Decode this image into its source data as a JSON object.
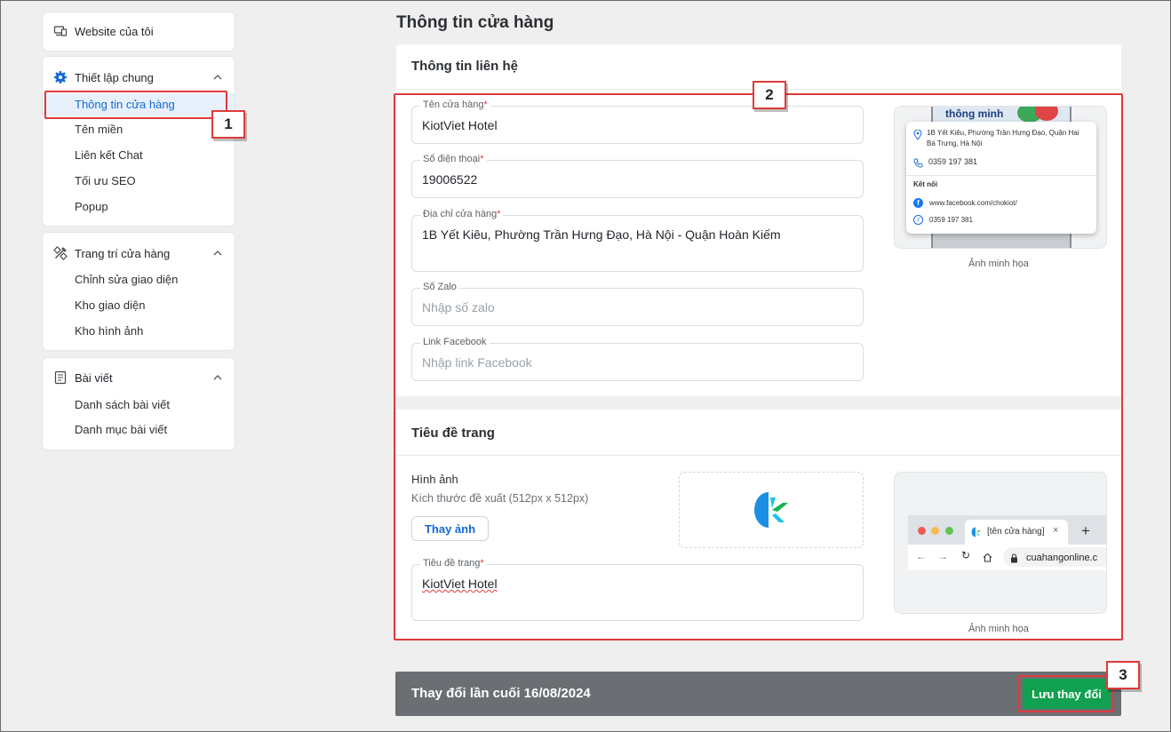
{
  "sidebar": {
    "website": "Website của tôi",
    "general": {
      "title": "Thiết lập chung",
      "items": [
        "Thông tin cửa hàng",
        "Tên miền",
        "Liên kết Chat",
        "Tối ưu SEO",
        "Popup"
      ]
    },
    "decor": {
      "title": "Trang trí cửa hàng",
      "items": [
        "Chỉnh sửa giao diện",
        "Kho giao diện",
        "Kho hình ảnh"
      ]
    },
    "posts": {
      "title": "Bài viết",
      "items": [
        "Danh sách bài viết",
        "Danh mục bài viết"
      ]
    }
  },
  "page_title": "Thông tin cửa hàng",
  "contact": {
    "title": "Thông tin liên hệ",
    "store_name": {
      "label": "Tên cửa hàng",
      "value": "KiotViet Hotel"
    },
    "phone": {
      "label": "Số điện thoại",
      "value": "19006522"
    },
    "address": {
      "label": "Địa chỉ cửa hàng",
      "value": "1B Yết Kiêu, Phường Trần Hưng Đạo, Hà Nội - Quận Hoàn Kiếm"
    },
    "zalo": {
      "label": "Số Zalo",
      "placeholder": "Nhập số zalo"
    },
    "facebook": {
      "label": "Link Facebook",
      "placeholder": "Nhập link Facebook"
    },
    "preview": {
      "brand": "thông minh",
      "address": "1B Yết Kiêu, Phường Trần Hưng Đạo, Quận Hai Bà Trưng, Hà Nội",
      "phone": "0359 197 381",
      "connect": "Kết nối",
      "fb": "www.facebook.com/chokiot/",
      "zalo": "0359 197 381",
      "caption": "Ảnh minh họa"
    }
  },
  "page_header": {
    "title": "Tiêu đề trang",
    "image_label": "Hình ảnh",
    "image_hint": "Kích thước đề xuất (512px x 512px)",
    "change_button": "Thay ảnh",
    "page_title_field": {
      "label": "Tiêu đề trang",
      "value": "KiotViet Hotel"
    },
    "browser": {
      "tab": "[tên cửa hàng]",
      "url": "cuahangonline.c"
    },
    "caption": "Ảnh minh họa"
  },
  "footer": {
    "last_changed": "Thay đổi lần cuối 16/08/2024",
    "save": "Lưu thay đổi"
  },
  "callouts": [
    "1",
    "2",
    "3"
  ],
  "colors": {
    "accent": "#1469d8",
    "save": "#12a150",
    "callout": "#e03a3a"
  }
}
